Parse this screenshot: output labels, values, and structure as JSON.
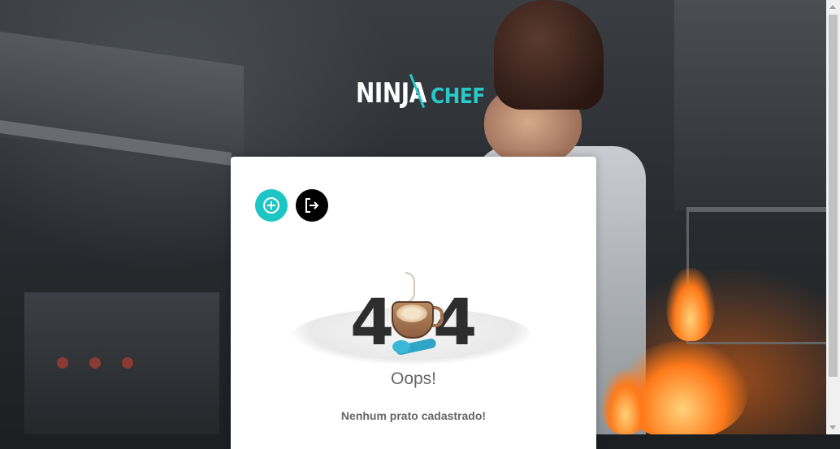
{
  "logo": {
    "text_ninja": "NINJA",
    "text_chef": "CHEF"
  },
  "actions": {
    "add_icon": "plus-circle-icon",
    "logout_icon": "sign-out-icon"
  },
  "empty_state": {
    "illustration": {
      "digit_left": "4",
      "digit_right": "4"
    },
    "title": "Oops!",
    "message": "Nenhum prato cadastrado!"
  },
  "colors": {
    "accent": "#1ec5c5",
    "logout_bg": "#000000",
    "text_muted": "#666666"
  }
}
